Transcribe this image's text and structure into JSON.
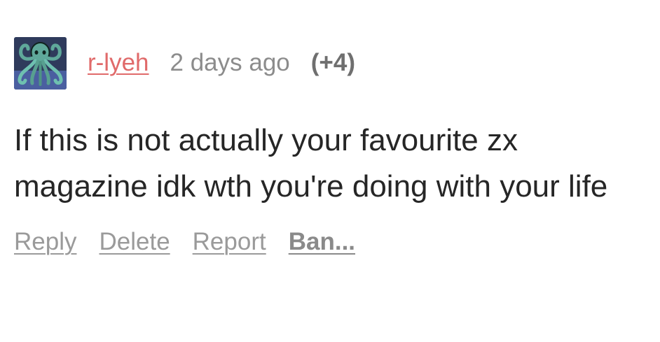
{
  "comment": {
    "avatar_icon": "octopus-avatar-icon",
    "username": "r-lyeh",
    "timestamp": "2 days ago",
    "score": "(+4)",
    "body": "If this is not actually your favourite zx magazine idk wth you're doing with your life",
    "actions": {
      "reply": "Reply",
      "delete": "Delete",
      "report": "Report",
      "ban": "Ban..."
    }
  },
  "colors": {
    "username": "#e06a6a",
    "timestamp": "#8c8c8c",
    "body_text": "#262626",
    "action_text": "#9a9a9a"
  }
}
